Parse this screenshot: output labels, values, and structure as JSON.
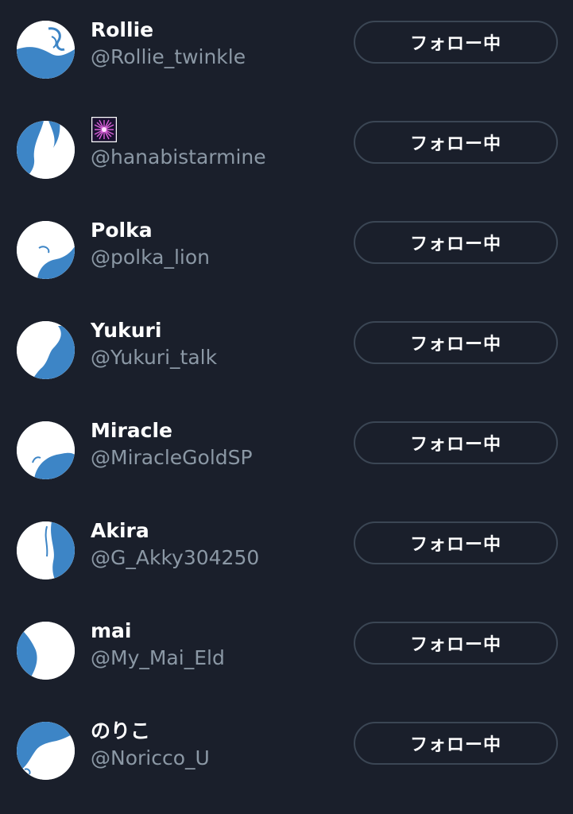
{
  "following": {
    "button_label": "フォロー中",
    "accent": "#3d85c6",
    "users": [
      {
        "name": "Rollie",
        "handle": "@Rollie_twinkle",
        "avatar_icon": "profile-avatar"
      },
      {
        "name": "",
        "name_icon": "fireworks-emoji",
        "handle": "@hanabistarmine",
        "avatar_icon": "profile-avatar"
      },
      {
        "name": "Polka",
        "handle": "@polka_lion",
        "avatar_icon": "profile-avatar"
      },
      {
        "name": "Yukuri",
        "handle": "@Yukuri_talk",
        "avatar_icon": "profile-avatar"
      },
      {
        "name": "Miracle",
        "handle": "@MiracleGoldSP",
        "avatar_icon": "profile-avatar"
      },
      {
        "name": "Akira",
        "handle": "@G_Akky304250",
        "avatar_icon": "profile-avatar"
      },
      {
        "name": "mai",
        "handle": "@My_Mai_Eld",
        "avatar_icon": "profile-avatar"
      },
      {
        "name": "のりこ",
        "handle": "@Noricco_U",
        "avatar_icon": "profile-avatar"
      }
    ]
  }
}
